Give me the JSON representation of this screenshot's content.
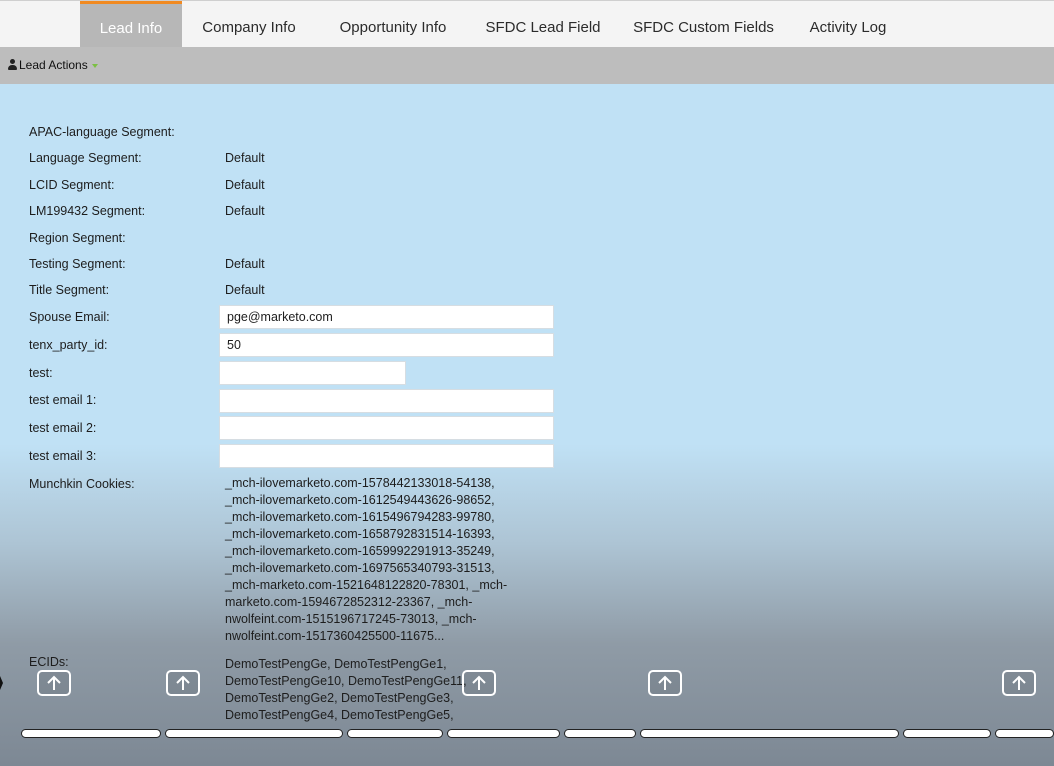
{
  "tabs": [
    {
      "label": "Lead Info",
      "active": true
    },
    {
      "label": "Company Info"
    },
    {
      "label": "Opportunity Info"
    },
    {
      "label": "SFDC Lead Field"
    },
    {
      "label": "SFDC Custom Fields"
    },
    {
      "label": "Activity Log"
    }
  ],
  "actions": {
    "label": "Lead Actions"
  },
  "fields": {
    "apac": {
      "label": "APAC-language Segment:",
      "value": ""
    },
    "language": {
      "label": "Language Segment:",
      "value": "Default"
    },
    "lcid": {
      "label": "LCID Segment:",
      "value": "Default"
    },
    "lm": {
      "label": "LM199432 Segment:",
      "value": "Default"
    },
    "region": {
      "label": "Region Segment:",
      "value": ""
    },
    "testing": {
      "label": "Testing Segment:",
      "value": "Default"
    },
    "title": {
      "label": "Title Segment:",
      "value": "Default"
    },
    "spouse_email": {
      "label": "Spouse Email:",
      "value": "pge@marketo.com"
    },
    "tenx": {
      "label": "tenx_party_id:",
      "value": "50"
    },
    "test": {
      "label": "test:",
      "value": ""
    },
    "test_email_1": {
      "label": "test email 1:",
      "value": ""
    },
    "test_email_2": {
      "label": "test email 2:",
      "value": ""
    },
    "test_email_3": {
      "label": "test email 3:",
      "value": ""
    },
    "munchkin": {
      "label": "Munchkin Cookies:",
      "lines": [
        "_mch-ilovemarketo.com-1578442133018-54138,",
        "_mch-ilovemarketo.com-1612549443626-98652,",
        "_mch-ilovemarketo.com-1615496794283-99780,",
        "_mch-ilovemarketo.com-1658792831514-16393,",
        "_mch-ilovemarketo.com-1659992291913-35249,",
        "_mch-ilovemarketo.com-1697565340793-31513,",
        "_mch-marketo.com-1521648122820-78301, _mch-",
        "marketo.com-1594672852312-23367, _mch-",
        "nwolfeint.com-1515196717245-73013, _mch-",
        "nwolfeint.com-1517360425500-11675..."
      ]
    },
    "ecids": {
      "label": "ECIDs:",
      "lines": [
        "DemoTestPengGe, DemoTestPengGe1,",
        "DemoTestPengGe10, DemoTestPengGe11,",
        "DemoTestPengGe2, DemoTestPengGe3,",
        "DemoTestPengGe4, DemoTestPengGe5,"
      ]
    }
  },
  "overlay": {
    "icon": "arrow-up-icon",
    "count": 5
  }
}
